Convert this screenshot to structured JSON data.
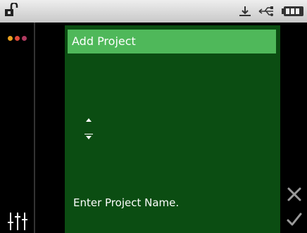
{
  "dialog": {
    "title": "Add Project",
    "prompt": "Enter Project Name."
  },
  "icons": {
    "lock": "unlocked-lock-icon",
    "download": "download-icon",
    "usb": "usb-icon",
    "battery": "battery-full-icon",
    "menu": "colored-dots-icon",
    "settings": "sliders-icon",
    "cancel": "close-icon",
    "confirm": "check-icon"
  },
  "colors": {
    "panel": "#0b4d12",
    "title_bar": "#4fb85a",
    "dot1": "#e8a020",
    "dot2": "#e04a3a",
    "dot3": "#b03a60"
  }
}
